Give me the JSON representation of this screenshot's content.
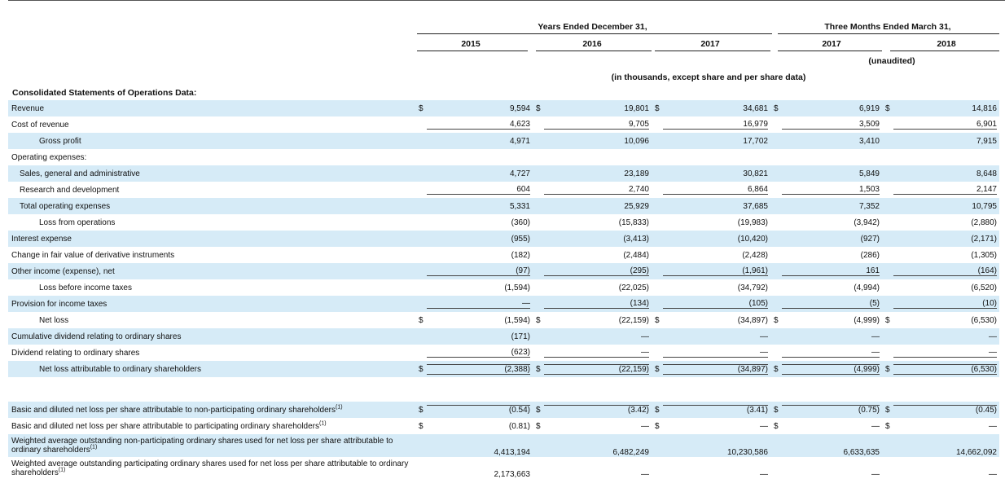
{
  "header": {
    "group_years": "Years Ended December 31,",
    "group_quarters": "Three Months Ended March 31,",
    "col_2015": "2015",
    "col_2016": "2016",
    "col_2017": "2017",
    "col_q2017": "2017",
    "col_q2018": "2018",
    "unaudited": "(unaudited)",
    "units": "(in thousands, except share and per share data)"
  },
  "section_title": "Consolidated Statements of Operations Data:",
  "currency_symbol": "$",
  "dash_symbol": "—",
  "rows": [
    {
      "label": "Revenue",
      "indent": 0,
      "shade": true,
      "cur": true,
      "values": [
        "9,594",
        "19,801",
        "34,681",
        "6,919",
        "14,816"
      ]
    },
    {
      "label": "Cost of revenue",
      "indent": 0,
      "shade": false,
      "cur": false,
      "values": [
        "4,623",
        "9,705",
        "16,979",
        "3,509",
        "6,901"
      ]
    },
    {
      "label": "Gross profit",
      "indent": 2,
      "shade": true,
      "cur": false,
      "values": [
        "4,971",
        "10,096",
        "17,702",
        "3,410",
        "7,915"
      ]
    },
    {
      "label": "Operating expenses:",
      "indent": 0,
      "shade": false,
      "cur": false,
      "values": [
        "",
        "",
        "",
        "",
        ""
      ]
    },
    {
      "label": "Sales, general and administrative",
      "indent": 1,
      "shade": true,
      "cur": false,
      "values": [
        "4,727",
        "23,189",
        "30,821",
        "5,849",
        "8,648"
      ]
    },
    {
      "label": "Research and development",
      "indent": 1,
      "shade": false,
      "cur": false,
      "values": [
        "604",
        "2,740",
        "6,864",
        "1,503",
        "2,147"
      ]
    },
    {
      "label": "Total operating expenses",
      "indent": 1,
      "shade": true,
      "cur": false,
      "values": [
        "5,331",
        "25,929",
        "37,685",
        "7,352",
        "10,795"
      ]
    },
    {
      "label": "Loss from operations",
      "indent": 2,
      "shade": false,
      "cur": false,
      "values": [
        "(360)",
        "(15,833)",
        "(19,983)",
        "(3,942)",
        "(2,880)"
      ]
    },
    {
      "label": "Interest expense",
      "indent": 0,
      "shade": true,
      "cur": false,
      "values": [
        "(955)",
        "(3,413)",
        "(10,420)",
        "(927)",
        "(2,171)"
      ]
    },
    {
      "label": "Change in fair value of derivative instruments",
      "indent": 0,
      "shade": false,
      "cur": false,
      "values": [
        "(182)",
        "(2,484)",
        "(2,428)",
        "(286)",
        "(1,305)"
      ]
    },
    {
      "label": "Other income (expense), net",
      "indent": 0,
      "shade": true,
      "cur": false,
      "values": [
        "(97)",
        "(295)",
        "(1,961)",
        "161",
        "(164)"
      ]
    },
    {
      "label": "Loss before income taxes",
      "indent": 2,
      "shade": false,
      "cur": false,
      "values": [
        "(1,594)",
        "(22,025)",
        "(34,792)",
        "(4,994)",
        "(6,520)"
      ]
    },
    {
      "label": "Provision for income taxes",
      "indent": 0,
      "shade": true,
      "cur": false,
      "values": [
        "—",
        "(134)",
        "(105)",
        "(5)",
        "(10)"
      ]
    },
    {
      "label": "Net loss",
      "indent": 2,
      "shade": false,
      "cur": true,
      "values": [
        "(1,594)",
        "(22,159)",
        "(34,897)",
        "(4,999)",
        "(6,530)"
      ]
    },
    {
      "label": "Cumulative dividend relating to ordinary shares",
      "indent": 0,
      "shade": true,
      "cur": false,
      "values": [
        "(171)",
        "—",
        "—",
        "—",
        "—"
      ]
    },
    {
      "label": "Dividend relating to ordinary shares",
      "indent": 0,
      "shade": false,
      "cur": false,
      "values": [
        "(623)",
        "—",
        "—",
        "—",
        "—"
      ]
    },
    {
      "label": "Net loss attributable to ordinary shareholders",
      "indent": 2,
      "shade": true,
      "cur": true,
      "values": [
        "(2,388)",
        "(22,159)",
        "(34,897)",
        "(4,999)",
        "(6,530)"
      ]
    }
  ],
  "per_share_rows": [
    {
      "label": "Basic and diluted net loss per share attributable to non-participating ordinary shareholders",
      "footnote": "(1)",
      "shade": true,
      "cur": true,
      "values": [
        "(0.54)",
        "(3.42)",
        "(3.41)",
        "(0.75)",
        "(0.45)"
      ]
    },
    {
      "label": "Basic and diluted net loss per share attributable to participating ordinary shareholders",
      "footnote": "(1)",
      "shade": false,
      "cur": true,
      "values": [
        "(0.81)",
        "—",
        "—",
        "—",
        "—"
      ]
    },
    {
      "label": "Weighted average outstanding non-participating ordinary shares used for net loss per share attributable to ordinary shareholders",
      "footnote": "(1)",
      "shade": true,
      "cur": false,
      "values": [
        "4,413,194",
        "6,482,249",
        "10,230,586",
        "6,633,635",
        "14,662,092"
      ]
    },
    {
      "label": "Weighted average outstanding participating ordinary shares used for net loss per share attributable to ordinary shareholders",
      "footnote": "(1)",
      "shade": false,
      "cur": false,
      "values": [
        "2,173,663",
        "—",
        "—",
        "—",
        "—"
      ]
    }
  ]
}
